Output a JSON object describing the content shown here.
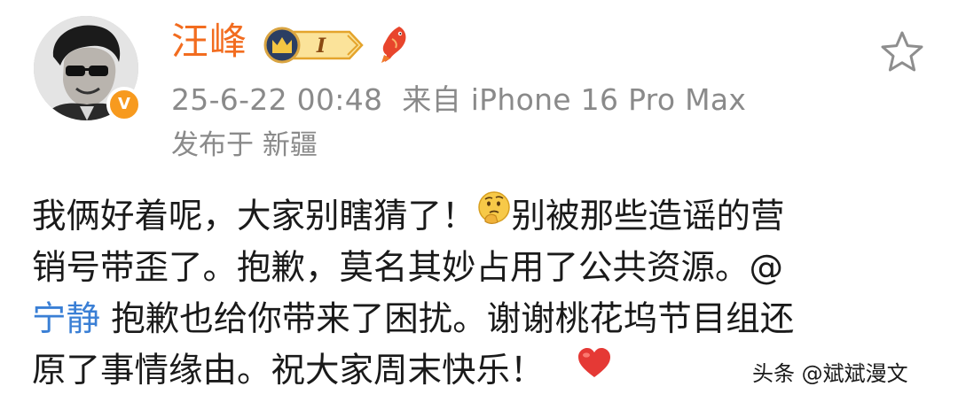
{
  "user": {
    "name": "汪峰",
    "vip_level": "I",
    "verified_mark": "V"
  },
  "meta": {
    "timestamp": "25-6-22 00:48",
    "source_prefix": "来自",
    "source_device": "iPhone 16 Pro Max",
    "location": "发布于 新疆"
  },
  "content": {
    "line1_text": "我俩好着呢，大家别瞎猜了！",
    "line1_after_emoji": "别被那些造谣的营",
    "line2": "销号带歪了。抱歉，莫名其妙占用了公共资源。@",
    "line3_mention": "宁静",
    "line3_rest": " 抱歉也给你带来了困扰。谢谢桃花坞节目组还",
    "line4": "原了事情缘由。祝大家周末快乐！"
  },
  "icons": {
    "thinking_emoji": "thinking-face-icon",
    "heart_emoji": "red-heart-icon",
    "star": "star-outline-icon",
    "koi": "koi-fish-icon",
    "crown": "crown-icon"
  },
  "colors": {
    "username": "#f26c1f",
    "meta_text": "#8a8a8a",
    "mention": "#3a7fd5",
    "verified_badge": "#f79a1e"
  },
  "watermark": "头条 @斌斌漫文"
}
